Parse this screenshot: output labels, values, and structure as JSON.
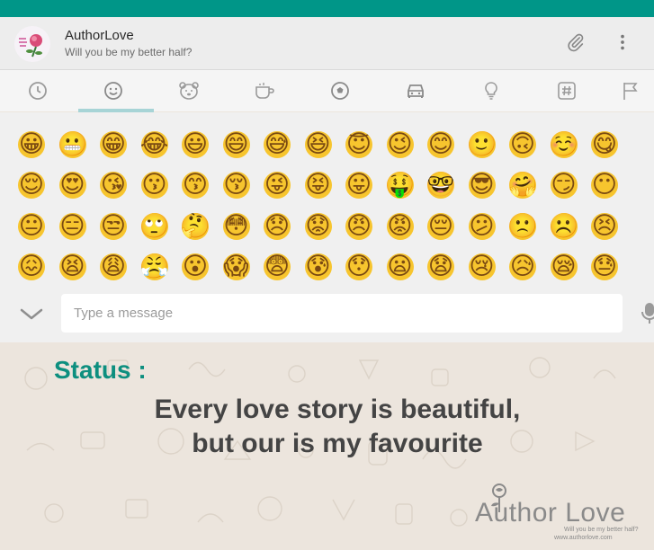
{
  "colors": {
    "accent": "#009688",
    "status_label": "#0d8f7f",
    "tab_indicator": "#a7d4d6",
    "emoji_face": "#f7c52e"
  },
  "chat": {
    "title": "AuthorLove",
    "subtitle": "Will you be my better half?"
  },
  "header_actions": [
    "paperclip-icon",
    "more-vert-icon"
  ],
  "emoji_tabs": [
    {
      "name": "recent-clock-icon",
      "active": false
    },
    {
      "name": "smiley-icon",
      "active": true
    },
    {
      "name": "animal-bear-icon",
      "active": false
    },
    {
      "name": "food-cup-icon",
      "active": false
    },
    {
      "name": "sports-ball-icon",
      "active": false
    },
    {
      "name": "travel-car-icon",
      "active": false
    },
    {
      "name": "objects-bulb-icon",
      "active": false
    },
    {
      "name": "symbols-hash-icon",
      "active": false
    },
    {
      "name": "flags-icon",
      "active": false
    }
  ],
  "emojis": [
    "😀",
    "😬",
    "😁",
    "😂",
    "😃",
    "😄",
    "😅",
    "😆",
    "😇",
    "😉",
    "😊",
    "🙂",
    "🙃",
    "☺️",
    "😋",
    "😌",
    "😍",
    "😘",
    "😗",
    "😙",
    "😚",
    "😜",
    "😝",
    "😛",
    "🤑",
    "🤓",
    "😎",
    "🤗",
    "😏",
    "😶",
    "😐",
    "😑",
    "😒",
    "🙄",
    "🤔",
    "😳",
    "😞",
    "😟",
    "😠",
    "😡",
    "😔",
    "😕",
    "🙁",
    "☹️",
    "😣",
    "😖",
    "😫",
    "😩",
    "😤",
    "😮",
    "😱",
    "😨",
    "😰",
    "😯",
    "😦",
    "😧",
    "😢",
    "😥",
    "😪",
    "😓"
  ],
  "composer": {
    "placeholder": "Type a message",
    "left_icon": "chevron-down-icon",
    "right_icon": "mic-icon"
  },
  "status": {
    "label": "Status :",
    "line1": "Every love story is beautiful,",
    "line2": "but our is my favourite"
  },
  "watermark": {
    "name": "Author Love",
    "tagline": "Will you be my better half?",
    "url": "www.authorlove.com"
  }
}
